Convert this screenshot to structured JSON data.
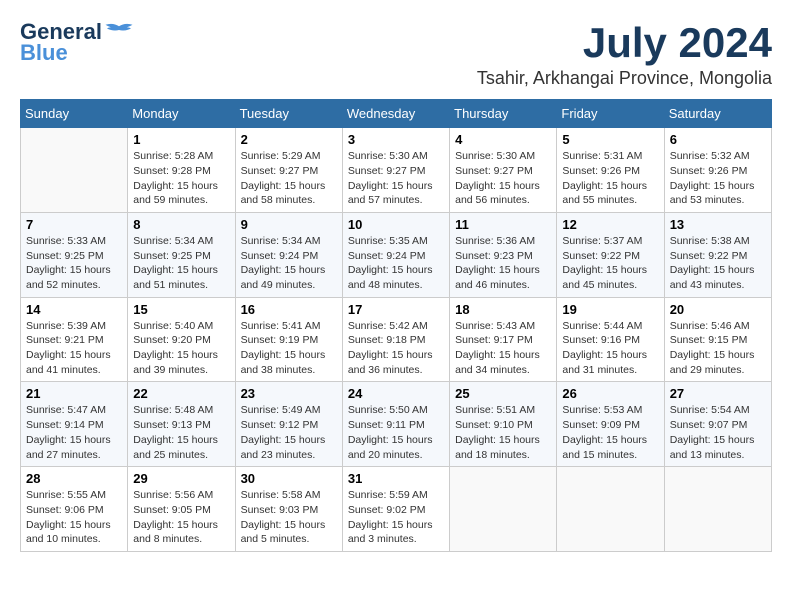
{
  "header": {
    "logo_line1": "General",
    "logo_line2": "Blue",
    "month_year": "July 2024",
    "location": "Tsahir, Arkhangai Province, Mongolia"
  },
  "calendar": {
    "days_of_week": [
      "Sunday",
      "Monday",
      "Tuesday",
      "Wednesday",
      "Thursday",
      "Friday",
      "Saturday"
    ],
    "weeks": [
      [
        {
          "day": "",
          "info": ""
        },
        {
          "day": "1",
          "info": "Sunrise: 5:28 AM\nSunset: 9:28 PM\nDaylight: 15 hours\nand 59 minutes."
        },
        {
          "day": "2",
          "info": "Sunrise: 5:29 AM\nSunset: 9:27 PM\nDaylight: 15 hours\nand 58 minutes."
        },
        {
          "day": "3",
          "info": "Sunrise: 5:30 AM\nSunset: 9:27 PM\nDaylight: 15 hours\nand 57 minutes."
        },
        {
          "day": "4",
          "info": "Sunrise: 5:30 AM\nSunset: 9:27 PM\nDaylight: 15 hours\nand 56 minutes."
        },
        {
          "day": "5",
          "info": "Sunrise: 5:31 AM\nSunset: 9:26 PM\nDaylight: 15 hours\nand 55 minutes."
        },
        {
          "day": "6",
          "info": "Sunrise: 5:32 AM\nSunset: 9:26 PM\nDaylight: 15 hours\nand 53 minutes."
        }
      ],
      [
        {
          "day": "7",
          "info": "Sunrise: 5:33 AM\nSunset: 9:25 PM\nDaylight: 15 hours\nand 52 minutes."
        },
        {
          "day": "8",
          "info": "Sunrise: 5:34 AM\nSunset: 9:25 PM\nDaylight: 15 hours\nand 51 minutes."
        },
        {
          "day": "9",
          "info": "Sunrise: 5:34 AM\nSunset: 9:24 PM\nDaylight: 15 hours\nand 49 minutes."
        },
        {
          "day": "10",
          "info": "Sunrise: 5:35 AM\nSunset: 9:24 PM\nDaylight: 15 hours\nand 48 minutes."
        },
        {
          "day": "11",
          "info": "Sunrise: 5:36 AM\nSunset: 9:23 PM\nDaylight: 15 hours\nand 46 minutes."
        },
        {
          "day": "12",
          "info": "Sunrise: 5:37 AM\nSunset: 9:22 PM\nDaylight: 15 hours\nand 45 minutes."
        },
        {
          "day": "13",
          "info": "Sunrise: 5:38 AM\nSunset: 9:22 PM\nDaylight: 15 hours\nand 43 minutes."
        }
      ],
      [
        {
          "day": "14",
          "info": "Sunrise: 5:39 AM\nSunset: 9:21 PM\nDaylight: 15 hours\nand 41 minutes."
        },
        {
          "day": "15",
          "info": "Sunrise: 5:40 AM\nSunset: 9:20 PM\nDaylight: 15 hours\nand 39 minutes."
        },
        {
          "day": "16",
          "info": "Sunrise: 5:41 AM\nSunset: 9:19 PM\nDaylight: 15 hours\nand 38 minutes."
        },
        {
          "day": "17",
          "info": "Sunrise: 5:42 AM\nSunset: 9:18 PM\nDaylight: 15 hours\nand 36 minutes."
        },
        {
          "day": "18",
          "info": "Sunrise: 5:43 AM\nSunset: 9:17 PM\nDaylight: 15 hours\nand 34 minutes."
        },
        {
          "day": "19",
          "info": "Sunrise: 5:44 AM\nSunset: 9:16 PM\nDaylight: 15 hours\nand 31 minutes."
        },
        {
          "day": "20",
          "info": "Sunrise: 5:46 AM\nSunset: 9:15 PM\nDaylight: 15 hours\nand 29 minutes."
        }
      ],
      [
        {
          "day": "21",
          "info": "Sunrise: 5:47 AM\nSunset: 9:14 PM\nDaylight: 15 hours\nand 27 minutes."
        },
        {
          "day": "22",
          "info": "Sunrise: 5:48 AM\nSunset: 9:13 PM\nDaylight: 15 hours\nand 25 minutes."
        },
        {
          "day": "23",
          "info": "Sunrise: 5:49 AM\nSunset: 9:12 PM\nDaylight: 15 hours\nand 23 minutes."
        },
        {
          "day": "24",
          "info": "Sunrise: 5:50 AM\nSunset: 9:11 PM\nDaylight: 15 hours\nand 20 minutes."
        },
        {
          "day": "25",
          "info": "Sunrise: 5:51 AM\nSunset: 9:10 PM\nDaylight: 15 hours\nand 18 minutes."
        },
        {
          "day": "26",
          "info": "Sunrise: 5:53 AM\nSunset: 9:09 PM\nDaylight: 15 hours\nand 15 minutes."
        },
        {
          "day": "27",
          "info": "Sunrise: 5:54 AM\nSunset: 9:07 PM\nDaylight: 15 hours\nand 13 minutes."
        }
      ],
      [
        {
          "day": "28",
          "info": "Sunrise: 5:55 AM\nSunset: 9:06 PM\nDaylight: 15 hours\nand 10 minutes."
        },
        {
          "day": "29",
          "info": "Sunrise: 5:56 AM\nSunset: 9:05 PM\nDaylight: 15 hours\nand 8 minutes."
        },
        {
          "day": "30",
          "info": "Sunrise: 5:58 AM\nSunset: 9:03 PM\nDaylight: 15 hours\nand 5 minutes."
        },
        {
          "day": "31",
          "info": "Sunrise: 5:59 AM\nSunset: 9:02 PM\nDaylight: 15 hours\nand 3 minutes."
        },
        {
          "day": "",
          "info": ""
        },
        {
          "day": "",
          "info": ""
        },
        {
          "day": "",
          "info": ""
        }
      ]
    ]
  }
}
